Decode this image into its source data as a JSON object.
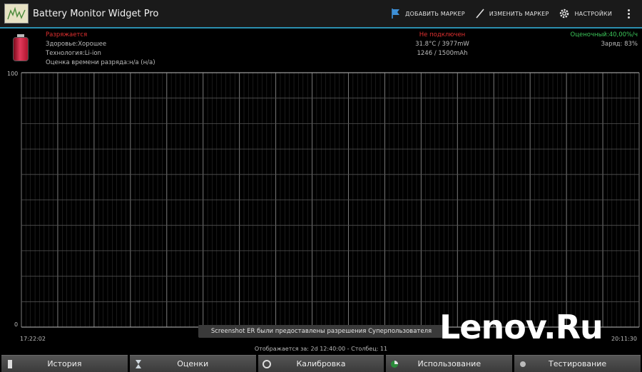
{
  "app": {
    "title": "Battery Monitor Widget Pro"
  },
  "actions": {
    "add_marker": "ДОБАВИТЬ МАРКЕР",
    "edit_marker": "ИЗМЕНИТЬ МАРКЕР",
    "settings": "НАСТРОЙКИ"
  },
  "status": {
    "state": "Разряжается",
    "health": "Здоровье:Хорошее",
    "technology": "Технология:Li-ion",
    "estimate": "Оценка времени разряда:н/а (н/а)",
    "plug": "Не подключен",
    "temp_power": "31.8°C / 3977mW",
    "capacity": "1246 / 1500mAh",
    "estimate_right": "Оценочный:40,00%/ч",
    "charge": "Заряд: 83%"
  },
  "chart": {
    "y_top": "100",
    "y_bottom": "0",
    "x_left": "17:22:02",
    "x_right": "20:11:30",
    "footer": "Отображается за: 2d 12:40:00 - Столбец: 11"
  },
  "toast": "Screenshot ER были предоставлены разрешения Суперпользователя",
  "watermark": "Lenov.Ru",
  "tabs": [
    "История",
    "Оценки",
    "Калибровка",
    "Использование",
    "Тестирование"
  ],
  "colors": {
    "accent": "#2b8fb0",
    "discharge": "#e03030",
    "estimate": "#3cc85a"
  }
}
